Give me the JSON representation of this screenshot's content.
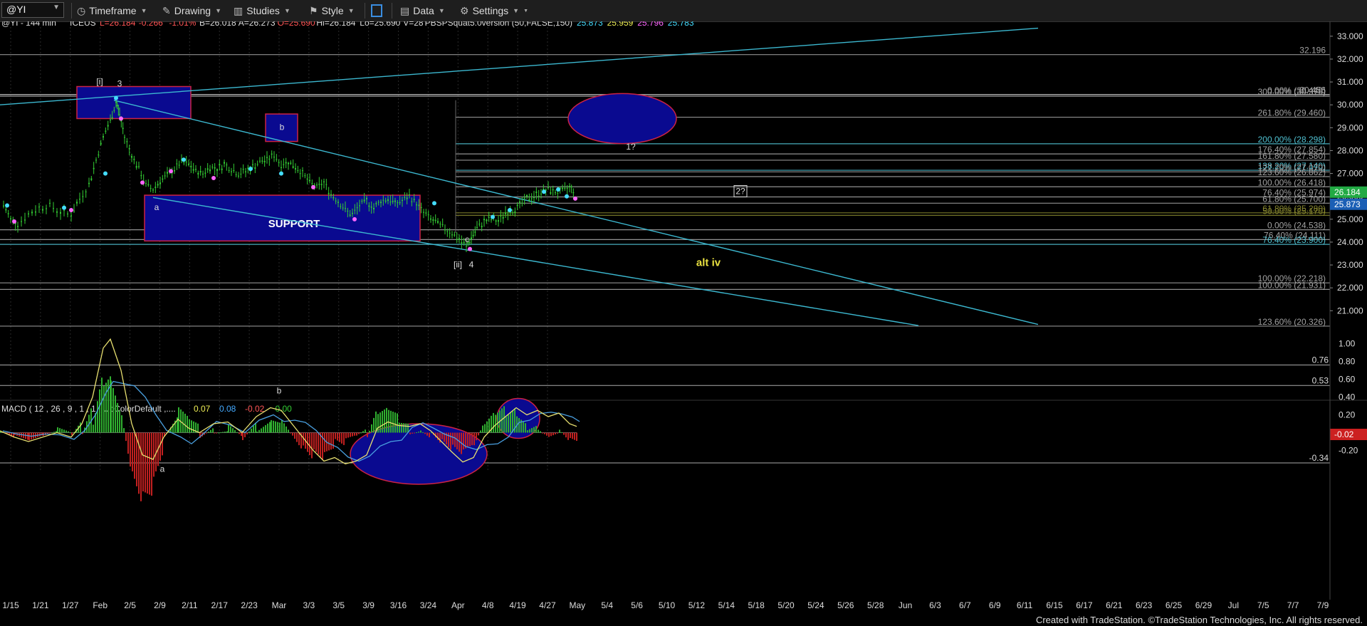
{
  "toolbar": {
    "symbol": "@YI",
    "items": [
      "Timeframe",
      "Drawing",
      "Studies",
      "Style",
      "Data",
      "Settings"
    ]
  },
  "header": {
    "name": "@YI - 144 min",
    "exchange": "ICEUS",
    "stats": [
      {
        "text": "L=26.184",
        "color": "#ff5555"
      },
      {
        "text": "-0.266",
        "color": "#ff5555"
      },
      {
        "text": "-1.01%",
        "color": "#ff5555"
      },
      {
        "text": "B=26.018",
        "color": "#dddddd"
      },
      {
        "text": "A=26.273",
        "color": "#dddddd"
      },
      {
        "text": "O=25.690",
        "color": "#ff5555"
      },
      {
        "text": "Hi=26.184",
        "color": "#dddddd"
      },
      {
        "text": "Lo=25.690",
        "color": "#dddddd"
      },
      {
        "text": "V=28",
        "color": "#dddddd"
      },
      {
        "text": "PBSPSquat5.0version (50,FALSE,150)",
        "color": "#dddddd"
      },
      {
        "text": "25.873",
        "color": "#44ddff"
      },
      {
        "text": "25.959",
        "color": "#eeee55"
      },
      {
        "text": "25.796",
        "color": "#ff66ff"
      },
      {
        "text": "25.783",
        "color": "#44ddff"
      }
    ]
  },
  "colors": {
    "background": "#000000",
    "candle": "#33cc33",
    "trendline": "#3cb8d0",
    "box_fill": "#0a0a90",
    "box_border": "#cc2244",
    "price_last": "#22aa44",
    "price_other": "#1b5fb5",
    "macd_line": "#e8e070",
    "signal_line": "#4aa0e0",
    "hist_pos": "#2fae2f",
    "hist_neg": "#c02020"
  },
  "chart_data": {
    "type": "candlestick",
    "price_axis": {
      "ylim": [
        20.2,
        33.4
      ],
      "ticks": [
        "33.000",
        "32.000",
        "31.000",
        "30.000",
        "29.000",
        "28.000",
        "27.000",
        "26.000",
        "25.000",
        "24.000",
        "23.000",
        "22.000",
        "21.000"
      ],
      "last_price": "26.184",
      "second_price": "25.873"
    },
    "time_axis": [
      "1/15",
      "1/21",
      "1/27",
      "Feb",
      "2/5",
      "2/9",
      "2/11",
      "2/17",
      "2/23",
      "Mar",
      "3/3",
      "3/5",
      "3/9",
      "3/16",
      "3/24",
      "Apr",
      "4/8",
      "4/19",
      "4/27",
      "May",
      "5/4",
      "5/6",
      "5/10",
      "5/12",
      "5/14",
      "5/18",
      "5/20",
      "5/24",
      "5/26",
      "5/28",
      "Jun",
      "6/3",
      "6/7",
      "6/9",
      "6/11",
      "6/15",
      "6/17",
      "6/21",
      "6/23",
      "6/25",
      "6/29",
      "Jul",
      "7/5",
      "7/7",
      "7/9"
    ],
    "levels": [
      {
        "label": "32.196",
        "value": 32.196,
        "color": "#aaaaaa"
      },
      {
        "label": "30.456",
        "value": 30.456,
        "color": "#aaaaaa"
      },
      {
        "label": "0.00% (30.440)",
        "value": 30.44,
        "color": "#aaaaaa"
      },
      {
        "label": "300.00% (30.376)",
        "value": 30.376,
        "color": "#aaaaaa"
      },
      {
        "label": "261.80% (29.460)",
        "value": 29.46,
        "color": "#aaaaaa"
      },
      {
        "label": "200.00% (28.298)",
        "value": 28.298,
        "color": "#55ccdd"
      },
      {
        "label": "176.40% (27.854)",
        "value": 27.854,
        "color": "#aaaaaa"
      },
      {
        "label": "161.80% (27.580)",
        "value": 27.58,
        "color": "#aaaaaa"
      },
      {
        "label": "138.20% (27.140)",
        "value": 27.14,
        "color": "#55ccdd"
      },
      {
        "label": "127.20% (27.070)",
        "value": 27.07,
        "color": "#aaaaaa"
      },
      {
        "label": "123.60% (26.862)",
        "value": 26.862,
        "color": "#aaaaaa"
      },
      {
        "label": "100.00% (26.418)",
        "value": 26.418,
        "color": "#aaaaaa"
      },
      {
        "label": "76.40% (25.974)",
        "value": 25.974,
        "color": "#aaaaaa"
      },
      {
        "label": "61.80% (25.700)",
        "value": 25.7,
        "color": "#aaaaaa"
      },
      {
        "label": "61.80% (25.280)",
        "value": 25.28,
        "color": "#8a8a30"
      },
      {
        "label": "50.00% (25.170)",
        "value": 25.17,
        "color": "#8a8a30"
      },
      {
        "label": "0.00% (24.538)",
        "value": 24.538,
        "color": "#aaaaaa"
      },
      {
        "label": "76.40% (24.111)",
        "value": 24.111,
        "color": "#aaaaaa"
      },
      {
        "label": "76.40% (23.900)",
        "value": 23.9,
        "color": "#55ccdd"
      },
      {
        "label": "100.00% (22.218)",
        "value": 22.218,
        "color": "#aaaaaa"
      },
      {
        "label": "100.00% (21.931)",
        "value": 21.931,
        "color": "#aaaaaa"
      },
      {
        "label": "123.60% (20.326)",
        "value": 20.326,
        "color": "#aaaaaa"
      }
    ],
    "wave_labels": [
      "[i]",
      "3",
      "b",
      "a",
      "[ii]",
      "4",
      "c",
      "1?",
      "2?",
      "alt iv"
    ],
    "box_labels": [
      "SUPPORT"
    ],
    "macd": {
      "title": "MACD ( 12 , 26 , 9 , 1 , 1 , UpColorDefault ,....",
      "values": [
        {
          "text": "0.07",
          "color": "#eeee55"
        },
        {
          "text": "0.08",
          "color": "#44aaff"
        },
        {
          "text": "-0.02",
          "color": "#ff5555"
        },
        {
          "text": "0.00",
          "color": "#33cc33"
        }
      ],
      "ylim": [
        -0.42,
        1.1
      ],
      "ticks": [
        "1.00",
        "0.80",
        "0.60",
        "0.40",
        "0.20",
        "-0.20"
      ],
      "levels": [
        {
          "label": "0.76",
          "value": 0.76
        },
        {
          "label": "0.53",
          "value": 0.53
        },
        {
          "label": "-0.34",
          "value": -0.34
        }
      ],
      "current": "-0.02",
      "wave_labels": [
        "b",
        "a"
      ]
    }
  },
  "footer": {
    "credit": "Created with TradeStation. ©TradeStation Technologies, Inc. All rights reserved."
  }
}
